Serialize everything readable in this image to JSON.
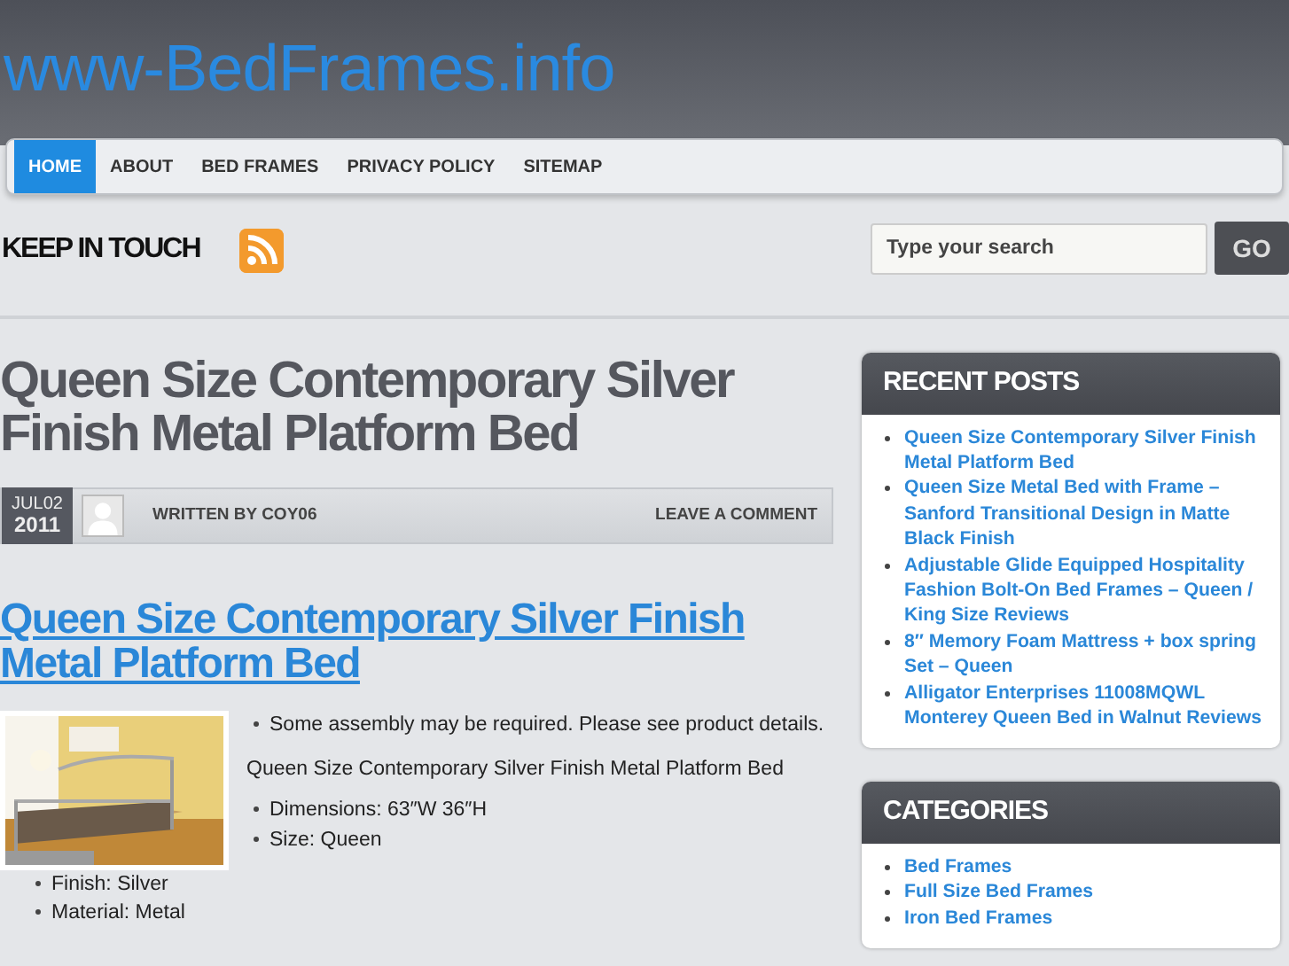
{
  "site_title": "www-BedFrames.info",
  "nav": [
    {
      "label": "HOME",
      "selected": true
    },
    {
      "label": "ABOUT",
      "selected": false
    },
    {
      "label": "BED FRAMES",
      "selected": false
    },
    {
      "label": "PRIVACY POLICY",
      "selected": false
    },
    {
      "label": "SITEMAP",
      "selected": false
    }
  ],
  "keep_in_touch": "KEEP IN TOUCH",
  "search": {
    "placeholder": "Type your search",
    "button": "GO"
  },
  "post": {
    "heading": "Queen Size Contemporary Silver Finish Metal Platform Bed",
    "date": {
      "month_day": "JUL02",
      "year": "2011"
    },
    "byline": "WRITTEN BY COY06",
    "comment_link": "LEAVE A COMMENT",
    "title_link": "Queen Size Contemporary Silver Finish Metal Platform Bed",
    "body": [
      {
        "kind": "bullet",
        "text": "Some assembly may be required. Please see product details."
      },
      {
        "kind": "paragraph",
        "text": "Queen Size Contemporary Silver Finish Metal Platform Bed"
      },
      {
        "kind": "bullet",
        "text": "Dimensions: 63″W 36″H"
      },
      {
        "kind": "bullet",
        "text": "Size: Queen"
      },
      {
        "kind": "bullet",
        "text": "Finish: Silver"
      },
      {
        "kind": "bullet",
        "text": "Material: Metal"
      }
    ]
  },
  "sidebar": [
    {
      "title": "RECENT POSTS",
      "items": [
        "Queen Size Contemporary Silver Finish Metal Platform Bed",
        "Queen Size Metal Bed with Frame – Sanford Transitional Design in Matte Black Finish",
        "Adjustable Glide Equipped Hospitality Fashion Bolt-On Bed Frames – Queen / King Size Reviews",
        "8″ Memory Foam Mattress + box spring Set – Queen",
        "Alligator Enterprises 11008MQWL Monterey Queen Bed in Walnut Reviews"
      ]
    },
    {
      "title": "CATEGORIES",
      "items": [
        "Bed Frames",
        "Full Size Bed Frames",
        "Iron Bed Frames"
      ]
    }
  ]
}
